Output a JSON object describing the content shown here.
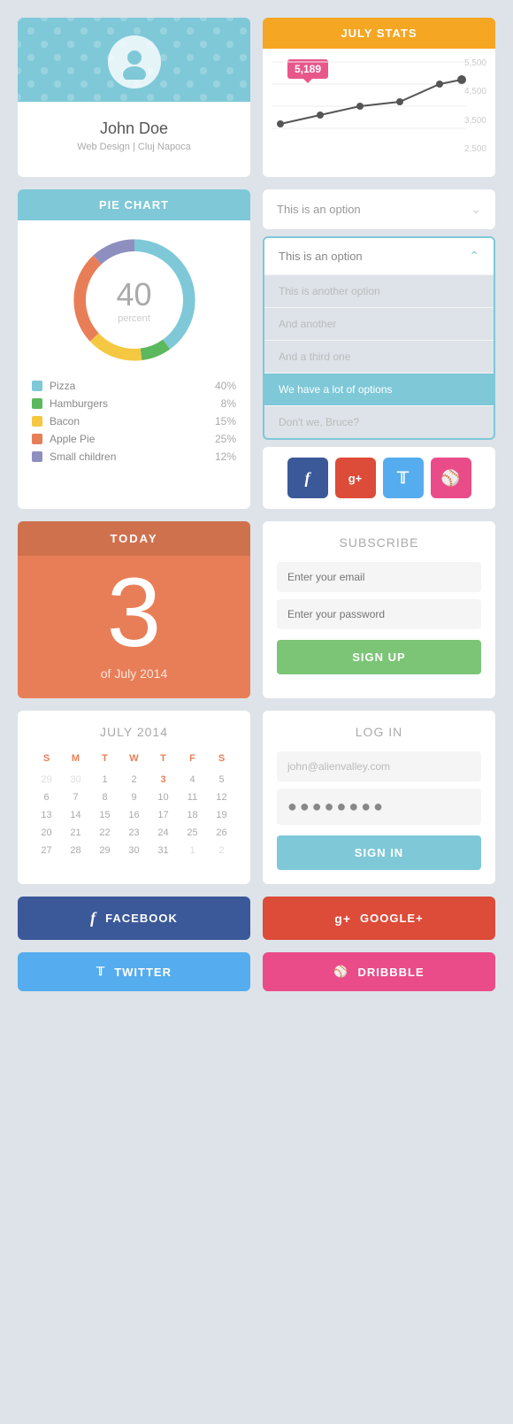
{
  "profile": {
    "name": "John Doe",
    "sub": "Web Design | Cluj Napoca"
  },
  "pie_chart": {
    "title": "PIE CHART",
    "center_value": "40",
    "center_label": "percent",
    "segments": [
      {
        "label": "Pizza",
        "pct": "40%",
        "color": "#7ec8d8",
        "value": 40
      },
      {
        "label": "Hamburgers",
        "pct": "8%",
        "color": "#5cb85c",
        "value": 8
      },
      {
        "label": "Bacon",
        "pct": "15%",
        "color": "#f5c842",
        "value": 15
      },
      {
        "label": "Apple Pie",
        "pct": "25%",
        "color": "#e87e57",
        "value": 25
      },
      {
        "label": "Small children",
        "pct": "12%",
        "color": "#8f8fbf",
        "value": 12
      }
    ]
  },
  "stats": {
    "title": "JULY STATS",
    "tooltip_value": "5,189",
    "chart_labels": [
      "5,500",
      "4,500",
      "3,500",
      "2,500"
    ]
  },
  "dropdown_closed": {
    "label": "This is an option"
  },
  "dropdown_open": {
    "header": "This is an option",
    "items": [
      {
        "label": "This is another option",
        "selected": false
      },
      {
        "label": "And another",
        "selected": false
      },
      {
        "label": "And a third one",
        "selected": false
      },
      {
        "label": "We have a lot of options",
        "selected": true
      },
      {
        "label": "Don't we, Bruce?",
        "selected": false
      }
    ]
  },
  "social_small": {
    "buttons": [
      "f",
      "g+",
      "t",
      "d"
    ]
  },
  "today": {
    "header": "TODAY",
    "number": "3",
    "sub": "of July 2014"
  },
  "subscribe": {
    "title": "SUBSCRIBE",
    "email_placeholder": "Enter your email",
    "password_placeholder": "Enter your password",
    "button_label": "SIGN UP"
  },
  "calendar": {
    "title": "JULY 2014",
    "day_names": [
      "S",
      "M",
      "T",
      "W",
      "T",
      "F",
      "S"
    ],
    "weeks": [
      [
        "29",
        "30",
        "1",
        "2",
        "3",
        "4",
        "5"
      ],
      [
        "6",
        "7",
        "8",
        "9",
        "10",
        "11",
        "12"
      ],
      [
        "13",
        "14",
        "15",
        "16",
        "17",
        "18",
        "19"
      ],
      [
        "20",
        "21",
        "22",
        "23",
        "24",
        "25",
        "26"
      ],
      [
        "27",
        "28",
        "29",
        "30",
        "31",
        "1",
        "2"
      ]
    ],
    "highlight_day": "3",
    "dim_days_first_row": [
      "29",
      "30"
    ],
    "dim_days_last_row": [
      "1",
      "2"
    ]
  },
  "login": {
    "title": "LOG IN",
    "email_value": "john@alienvalley.com",
    "password_dots": "●●●●●●●●",
    "button_label": "SIGN IN"
  },
  "bottom_social": {
    "buttons": [
      {
        "label": "FACEBOOK",
        "icon": "f",
        "class": "bottom-fb"
      },
      {
        "label": "GOOGLE+",
        "icon": "g+",
        "class": "bottom-gp"
      },
      {
        "label": "TWITTER",
        "icon": "t",
        "class": "bottom-tw"
      },
      {
        "label": "DRIBBBLE",
        "icon": "d",
        "class": "bottom-dr"
      }
    ]
  }
}
